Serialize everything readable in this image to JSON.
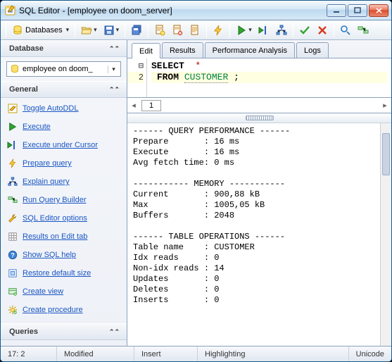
{
  "window": {
    "title": "SQL Editor - [employee on doom_server]"
  },
  "toolbar": {
    "databases_label": "Databases"
  },
  "sidebar": {
    "sections": {
      "database": "Database",
      "general": "General",
      "queries": "Queries"
    },
    "db_selected": "employee on doom_",
    "general_items": [
      "Toggle AutoDDL",
      "Execute",
      "Execute under Cursor",
      "Prepare query",
      "Explain query",
      "Run Query Builder",
      "SQL Editor options",
      "Results on Edit tab",
      "Show SQL help",
      "Restore default size",
      "Create view",
      "Create procedure"
    ]
  },
  "tabs": [
    "Edit",
    "Results",
    "Performance Analysis",
    "Logs"
  ],
  "active_tab": "Edit",
  "sql": {
    "line1_kw": "SELECT",
    "line1_star": "*",
    "line2_kw": "FROM",
    "line2_tbl": "CUSTOMER",
    "line2_semi": ";",
    "gutter2": "2"
  },
  "page_indicator": "1",
  "output_lines": [
    "------ QUERY PERFORMANCE ------",
    "Prepare       : 16 ms",
    "Execute       : 16 ms",
    "Avg fetch time: 0 ms",
    "",
    "----------- MEMORY -----------",
    "Current       : 900,88 kB",
    "Max           : 1005,05 kB",
    "Buffers       : 2048",
    "",
    "------ TABLE OPERATIONS ------",
    "Table name    : CUSTOMER",
    "Idx reads     : 0",
    "Non-idx reads : 14",
    "Updates       : 0",
    "Deletes       : 0",
    "Inserts       : 0"
  ],
  "statusbar": {
    "pos": "17:   2",
    "modified": "Modified",
    "insert": "Insert",
    "highlight": "Highlighting",
    "encoding": "Unicode"
  },
  "colors": {
    "accent": "#1a56c4",
    "kw_green": "#008040"
  }
}
